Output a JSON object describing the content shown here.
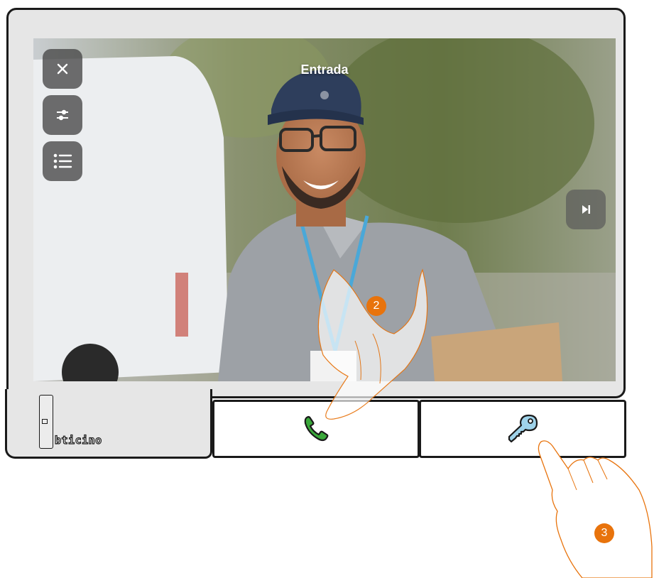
{
  "camera": {
    "title": "Entrada"
  },
  "controls": {
    "close_icon": "close-icon",
    "settings_icon": "sliders-icon",
    "menu_icon": "list-icon",
    "next_icon": "skip-next-icon"
  },
  "device_buttons": {
    "answer_icon": "phone-handset-icon",
    "door_icon": "key-icon"
  },
  "brand": {
    "logo": "bticino"
  },
  "steps": {
    "answer_step": "2",
    "door_step": "3"
  },
  "colors": {
    "accent": "#e8730c",
    "answer_green": "#3aa83a",
    "key_blue": "#9fd3ea"
  }
}
